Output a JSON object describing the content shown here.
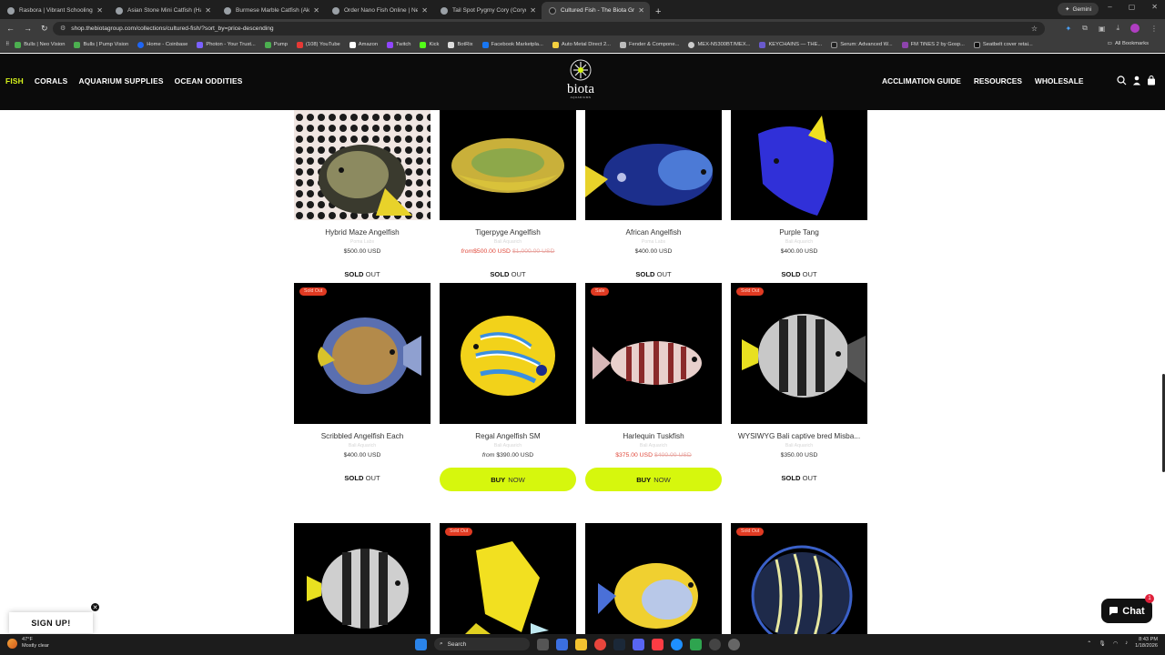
{
  "browser": {
    "tabs": [
      {
        "title": "Rasbora | Vibrant Schooling Fish",
        "active": false
      },
      {
        "title": "Asian Stone Mini Catfish (Hara...",
        "active": false
      },
      {
        "title": "Burmese Marble Catfish (Akysis...",
        "active": false
      },
      {
        "title": "Order Nano Fish Online | Next...",
        "active": false
      },
      {
        "title": "Tail Spot Pygmy Cory (Corydo...",
        "active": false
      },
      {
        "title": "Cultured Fish - The Biota Group",
        "active": true
      }
    ],
    "new_tab": "+",
    "gemini_label": "Gemini",
    "url": "shop.thebiotagroup.com/collections/cultured-fish/?sort_by=price-descending",
    "bookmarks": [
      "Bulls | Neo Vision",
      "Bulls | Pump Vision",
      "Home - Coinbase",
      "Photon - Your Trust...",
      "Pump",
      "(108) YouTube",
      "Amazon",
      "Twitch",
      "Kick",
      "BotRix",
      "Facebook Marketpla...",
      "Auto Metal Direct 2...",
      "Fender & Compone...",
      "MEX-N5300BT/MEX...",
      "KEYCHAINS — THE...",
      "Serum: Advanced W...",
      "FM TiNES 2 by Gosp...",
      "Seatbelt cover retai..."
    ],
    "all_bookmarks": "All Bookmarks"
  },
  "site": {
    "nav_left": [
      "FISH",
      "CORALS",
      "AQUARIUM SUPPLIES",
      "OCEAN ODDITIES"
    ],
    "nav_right": [
      "ACCLIMATION GUIDE",
      "RESOURCES",
      "WHOLESALE"
    ],
    "logo_word": "biota",
    "logo_sub": "AQUARIUMS"
  },
  "products_row1": [
    {
      "title": "Hybrid Maze Angelfish",
      "vendor": "Poma Labs",
      "price": "$500.00 USD",
      "action": "SOLD",
      "action2": "OUT"
    },
    {
      "title": "Tigerpyge Angelfish",
      "vendor": "Bali Aquarich",
      "from": "from",
      "price": "$500.00 USD",
      "compare": "$1,000.00 USD",
      "action": "SOLD",
      "action2": "OUT"
    },
    {
      "title": "African Angelfish",
      "vendor": "Poma Labs",
      "price": "$400.00 USD",
      "action": "SOLD",
      "action2": "OUT"
    },
    {
      "title": "Purple Tang",
      "vendor": "Bali Aquarich",
      "price": "$400.00 USD",
      "action": "SOLD",
      "action2": "OUT"
    }
  ],
  "products_row2": [
    {
      "badge": "Sold Out",
      "title": "Scribbled Angelfish Each",
      "vendor": "Bali Aquarich",
      "price": "$400.00 USD",
      "action": "SOLD",
      "action2": "OUT"
    },
    {
      "title": "Regal Angelfish SM",
      "vendor": "Bali Aquarich",
      "from": "from",
      "price": "$390.00 USD",
      "action": "BUY",
      "action2": "NOW"
    },
    {
      "badge": "Sale",
      "title": "Harlequin Tuskfish",
      "vendor": "Bali Aquarich",
      "price": "$375.00 USD",
      "compare": "$400.00 USD",
      "action": "BUY",
      "action2": "NOW"
    },
    {
      "badge": "Sold Out",
      "title": "WYSIWYG Bali captive bred Misba...",
      "vendor": "Bali Aquarich",
      "price": "$350.00 USD",
      "action": "SOLD",
      "action2": "OUT"
    }
  ],
  "products_row3": [
    {
      "badge": ""
    },
    {
      "badge": "Sold Out"
    },
    {
      "badge": ""
    },
    {
      "badge": "Sold Out"
    }
  ],
  "popups": {
    "signup": "SIGN UP!",
    "close": "✕",
    "chat": "Chat",
    "chat_count": "1"
  },
  "taskbar": {
    "temp": "47°F",
    "weather": "Mostly clear",
    "search": "Search",
    "time": "8:43 PM",
    "date": "1/18/2026"
  }
}
